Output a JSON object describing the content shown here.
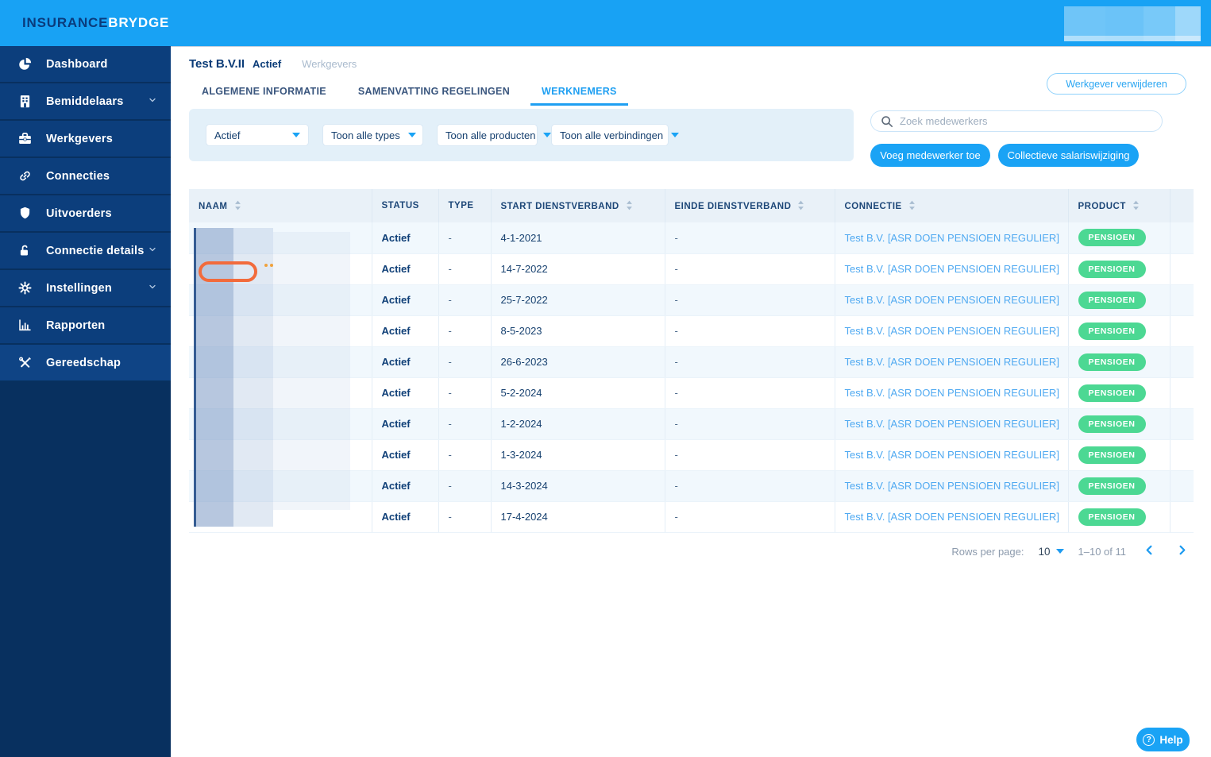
{
  "brand": {
    "logo_primary": "INSURANCE",
    "logo_secondary": "BRYDGE"
  },
  "sidebar": {
    "items": [
      {
        "label": "Dashboard",
        "icon": "pie-chart",
        "expandable": false
      },
      {
        "label": "Bemiddelaars",
        "icon": "building",
        "expandable": true
      },
      {
        "label": "Werkgevers",
        "icon": "briefcase",
        "expandable": false
      },
      {
        "label": "Connecties",
        "icon": "link",
        "expandable": false
      },
      {
        "label": "Uitvoerders",
        "icon": "shield",
        "expandable": false
      },
      {
        "label": "Connectie details",
        "icon": "lock-open",
        "expandable": true
      },
      {
        "label": "Instellingen",
        "icon": "gear",
        "expandable": true
      },
      {
        "label": "Rapporten",
        "icon": "bar-chart",
        "expandable": false
      },
      {
        "label": "Gereedschap",
        "icon": "tools",
        "expandable": false
      }
    ]
  },
  "header": {
    "title": "Test B.V.II",
    "status": "Actief",
    "breadcrumb": "Werkgevers",
    "delete_button": "Werkgever verwijderen"
  },
  "tabs": [
    {
      "label": "ALGEMENE INFORMATIE",
      "active": false
    },
    {
      "label": "SAMENVATTING REGELINGEN",
      "active": false
    },
    {
      "label": "WERKNEMERS",
      "active": true
    }
  ],
  "filters": {
    "status": "Actief",
    "types": "Toon alle types",
    "products": "Toon alle producten",
    "connections": "Toon alle verbindingen"
  },
  "search": {
    "placeholder": "Zoek medewerkers"
  },
  "actions": {
    "add_employee": "Voeg medewerker toe",
    "collective_salary": "Collectieve salariswijziging"
  },
  "table": {
    "columns": [
      {
        "label": "NAAM",
        "sortable": true
      },
      {
        "label": "STATUS",
        "sortable": false
      },
      {
        "label": "TYPE",
        "sortable": false
      },
      {
        "label": "START DIENSTVERBAND",
        "sortable": true
      },
      {
        "label": "EINDE DIENSTVERBAND",
        "sortable": true
      },
      {
        "label": "CONNECTIE",
        "sortable": true
      },
      {
        "label": "PRODUCT",
        "sortable": true
      },
      {
        "label": "",
        "sortable": false
      }
    ],
    "rows": [
      {
        "name": "",
        "status": "Actief",
        "type": "-",
        "start": "4-1-2021",
        "end": "-",
        "connection": "Test B.V. [ASR DOEN PENSIOEN REGULIER]",
        "product": "PENSIOEN"
      },
      {
        "name": "",
        "status": "Actief",
        "type": "-",
        "start": "14-7-2022",
        "end": "-",
        "connection": "Test B.V. [ASR DOEN PENSIOEN REGULIER]",
        "product": "PENSIOEN"
      },
      {
        "name": "",
        "status": "Actief",
        "type": "-",
        "start": "25-7-2022",
        "end": "-",
        "connection": "Test B.V. [ASR DOEN PENSIOEN REGULIER]",
        "product": "PENSIOEN"
      },
      {
        "name": "",
        "status": "Actief",
        "type": "-",
        "start": "8-5-2023",
        "end": "-",
        "connection": "Test B.V. [ASR DOEN PENSIOEN REGULIER]",
        "product": "PENSIOEN"
      },
      {
        "name": "",
        "status": "Actief",
        "type": "-",
        "start": "26-6-2023",
        "end": "-",
        "connection": "Test B.V. [ASR DOEN PENSIOEN REGULIER]",
        "product": "PENSIOEN"
      },
      {
        "name": "",
        "status": "Actief",
        "type": "-",
        "start": "5-2-2024",
        "end": "-",
        "connection": "Test B.V. [ASR DOEN PENSIOEN REGULIER]",
        "product": "PENSIOEN"
      },
      {
        "name": "",
        "status": "Actief",
        "type": "-",
        "start": "1-2-2024",
        "end": "-",
        "connection": "Test B.V. [ASR DOEN PENSIOEN REGULIER]",
        "product": "PENSIOEN"
      },
      {
        "name": "",
        "status": "Actief",
        "type": "-",
        "start": "1-3-2024",
        "end": "-",
        "connection": "Test B.V. [ASR DOEN PENSIOEN REGULIER]",
        "product": "PENSIOEN"
      },
      {
        "name": "",
        "status": "Actief",
        "type": "-",
        "start": "14-3-2024",
        "end": "-",
        "connection": "Test B.V. [ASR DOEN PENSIOEN REGULIER]",
        "product": "PENSIOEN"
      },
      {
        "name": "",
        "status": "Actief",
        "type": "-",
        "start": "17-4-2024",
        "end": "-",
        "connection": "Test B.V. [ASR DOEN PENSIOEN REGULIER]",
        "product": "PENSIOEN"
      }
    ]
  },
  "pagination": {
    "rows_per_page_label": "Rows per page:",
    "rows_per_page": "10",
    "range": "1–10 of 11"
  },
  "help": {
    "label": "Help"
  },
  "colors": {
    "topbar_blue": "#18A2F4",
    "sidebar_navy": "#0C3E7C",
    "sidebar_dark": "#08305F",
    "accent_blue": "#1AA3F5",
    "link_blue": "#4FA9F1",
    "badge_green": "#4CD893",
    "annotation_orange": "#F26B3C",
    "filter_panel": "#E3F0F9",
    "table_header_bg": "#E9F1F8",
    "row_alt_bg": "#F1F8FD"
  }
}
